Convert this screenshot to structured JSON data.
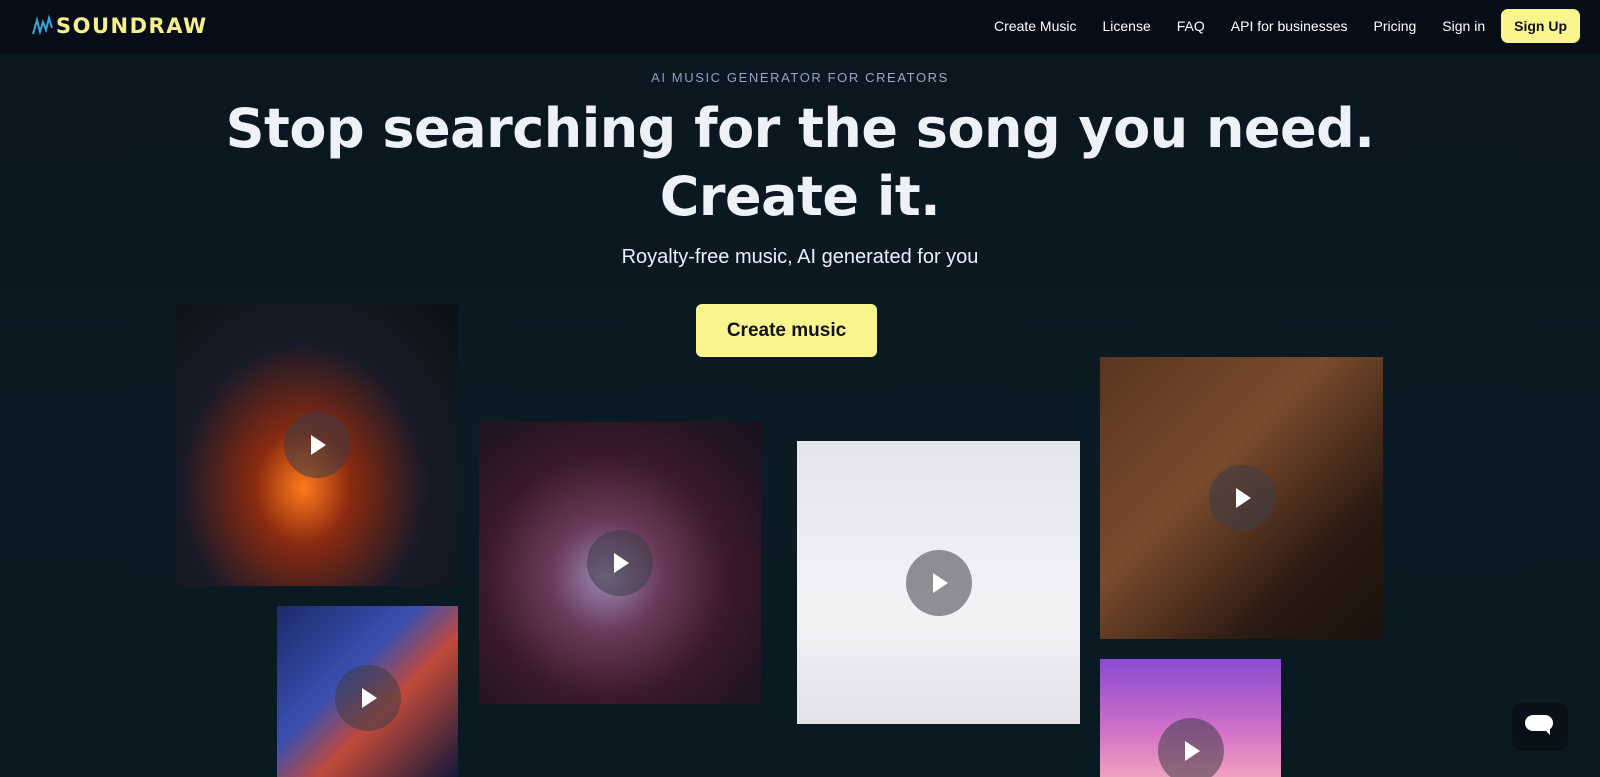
{
  "brand": {
    "name": "SOUNDRAW",
    "logo_color": "#f8f08a"
  },
  "nav": {
    "items": [
      "Create Music",
      "License",
      "FAQ",
      "API for businesses",
      "Pricing",
      "Sign in"
    ],
    "signup": "Sign Up"
  },
  "hero": {
    "eyebrow": "AI MUSIC GENERATOR FOR CREATORS",
    "title_line1": "Stop searching for the song you need.",
    "title_line2": "Create it.",
    "subtitle": "Royalty-free music, AI generated for you",
    "cta": "Create music",
    "accent": "#fbf58e"
  },
  "tiles": [
    {
      "name": "concert-video",
      "icon": "play-icon"
    },
    {
      "name": "city-night-video",
      "icon": "play-icon"
    },
    {
      "name": "disco-ball-video",
      "icon": "play-icon"
    },
    {
      "name": "dancer-video",
      "icon": "play-icon"
    },
    {
      "name": "piano-video",
      "icon": "play-icon"
    },
    {
      "name": "palm-sunset-video",
      "icon": "play-icon"
    }
  ],
  "chat": {
    "icon": "chat-bubble-icon"
  }
}
